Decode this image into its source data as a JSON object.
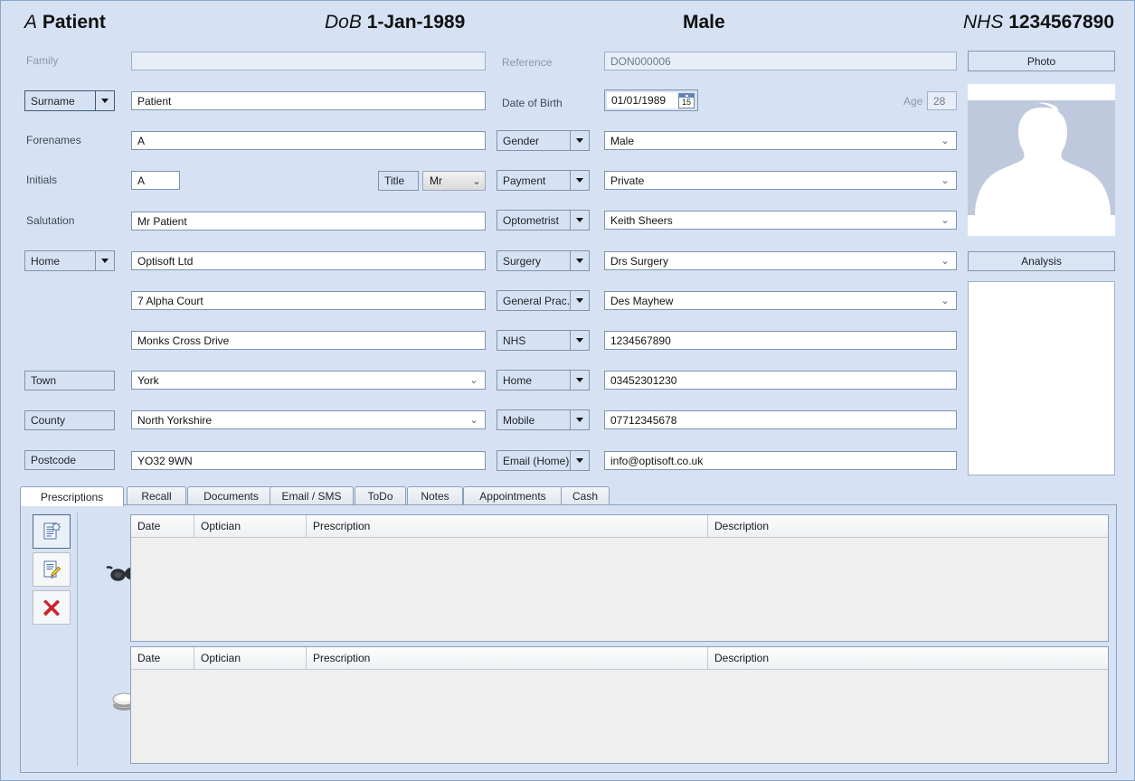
{
  "header": {
    "name_initial": "A",
    "name_surname": "Patient",
    "dob_label": "DoB",
    "dob_value": "1-Jan-1989",
    "gender": "Male",
    "nhs_label": "NHS",
    "nhs_value": "1234567890"
  },
  "form": {
    "family_label": "Family",
    "family_value": "",
    "reference_label": "Reference",
    "reference_value": "DON000006",
    "name_type_label": "Surname",
    "surname_value": "Patient",
    "dob_field_label": "Date of Birth",
    "dob_field_value": "01/01/1989",
    "age_label": "Age",
    "age_value": "28",
    "forenames_label": "Forenames",
    "forenames_value": "A",
    "gender_label": "Gender",
    "gender_value": "Male",
    "initials_label": "Initials",
    "initials_value": "A",
    "title_label": "Title",
    "title_value": "Mr",
    "payment_label": "Payment",
    "payment_value": "Private",
    "salutation_label": "Salutation",
    "salutation_value": "Mr Patient",
    "optometrist_label": "Optometrist",
    "optometrist_value": "Keith Sheers",
    "address_type_label": "Home",
    "address_line1": "Optisoft Ltd",
    "surgery_label": "Surgery",
    "surgery_value": "Drs Surgery",
    "address_line2": "7 Alpha Court",
    "gp_label": "General Prac..",
    "gp_value": "Des Mayhew",
    "address_line3": "Monks Cross Drive",
    "nhs_field_label": "NHS",
    "nhs_field_value": "1234567890",
    "town_label": "Town",
    "town_value": "York",
    "home_phone_label": "Home",
    "home_phone_value": "03452301230",
    "county_label": "County",
    "county_value": "North Yorkshire",
    "mobile_label": "Mobile",
    "mobile_value": "07712345678",
    "postcode_label": "Postcode",
    "postcode_value": "YO32 9WN",
    "email_label": "Email (Home)",
    "email_value": "info@optisoft.co.uk"
  },
  "side_panel": {
    "photo_button": "Photo",
    "analysis_button": "Analysis"
  },
  "tabs": [
    {
      "label": "Prescriptions",
      "selected": true
    },
    {
      "label": "Recall",
      "selected": false
    },
    {
      "label": "Documents",
      "selected": false
    },
    {
      "label": "Email / SMS",
      "selected": false
    },
    {
      "label": "ToDo",
      "selected": false
    },
    {
      "label": "Notes",
      "selected": false
    },
    {
      "label": "Appointments",
      "selected": false
    },
    {
      "label": "Cash",
      "selected": false
    }
  ],
  "toolbar": {
    "new_label": "new-prescription",
    "edit_label": "edit-prescription",
    "delete_label": "delete-prescription"
  },
  "grids": {
    "spectacles": {
      "icon": "glasses-icon",
      "columns": [
        "Date",
        "Optician",
        "Prescription",
        "Description"
      ],
      "rows": []
    },
    "contact_lenses": {
      "icon": "contact-lens-case-icon",
      "columns": [
        "Date",
        "Optician",
        "Prescription",
        "Description"
      ],
      "rows": []
    }
  },
  "colors": {
    "background": "#d6e2f4",
    "field_border": "#7f94ab",
    "accent": "#5b84c2",
    "delete_red": "#cc2229"
  }
}
